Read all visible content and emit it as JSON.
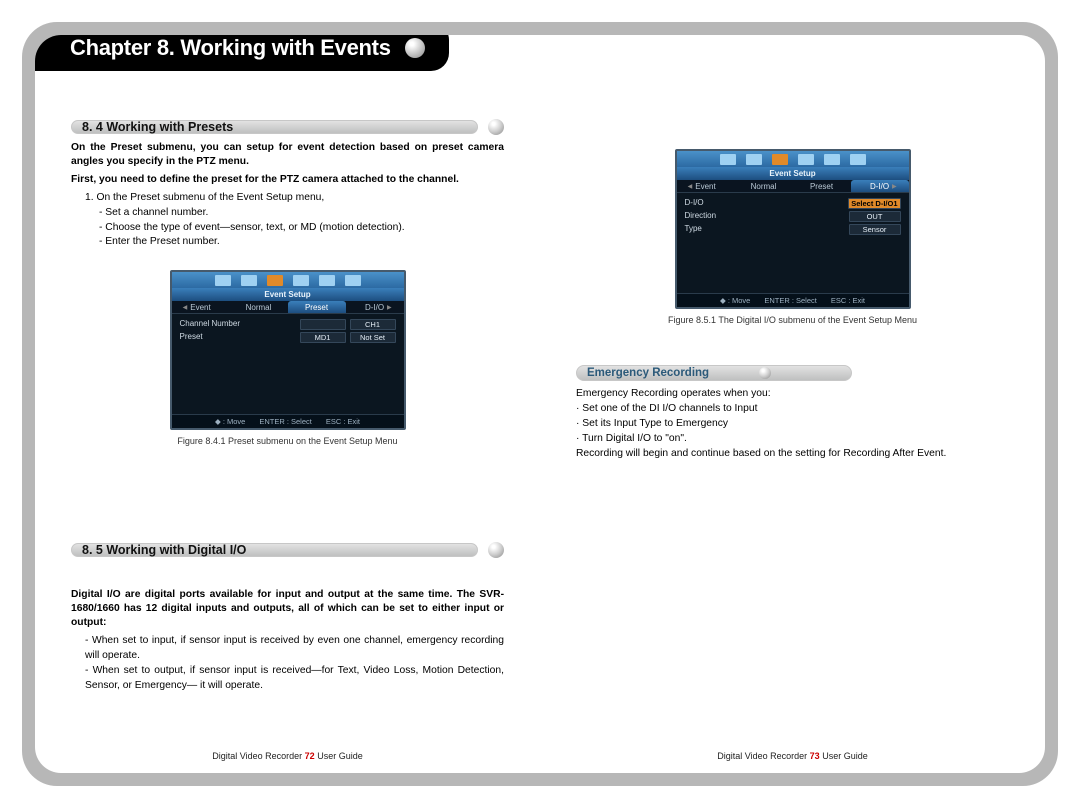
{
  "chapter_title": "Chapter 8. Working with Events",
  "left": {
    "sec84_title": "8. 4 Working with Presets",
    "p1": "On the Preset submenu, you can setup for event detection based on preset camera angles you specify in the PTZ menu.",
    "p2": "First, you need to define the preset for the PTZ camera attached to the channel.",
    "step1_intro": "1.   On the Preset submenu of the Event Setup menu,",
    "step1_a": "- Set a channel number.",
    "step1_b": "- Choose the type of event—sensor, text, or MD (motion detection).",
    "step1_c": "- Enter the Preset number.",
    "fig_caption": "Figure 8.4.1 Preset submenu on the Event Setup Menu",
    "sec85_title": "8. 5 Working with Digital I/O",
    "dio_p1": "Digital I/O are digital ports available for input and output at the same time. The SVR-1680/1660 has 12 digital inputs and outputs, all of which can be set to either input or output:",
    "dio_b1": "-  When set to input, if sensor input is received by even one channel, emergency recording will operate.",
    "dio_b2": "- When set to output, if sensor input is received—for Text, Video Loss, Motion Detection, Sensor, or Emergency— it will operate.",
    "footer_pre": "Digital Video Recorder ",
    "footer_page": "72",
    "footer_post": " User Guide"
  },
  "right": {
    "fig_caption": "Figure 8.5.1 The Digital I/O submenu of the Event Setup Menu",
    "emergency_title": "Emergency Recording",
    "er_p1": "Emergency Recording operates when you:",
    "er_b1": "· Set one of the DI I/O channels to Input",
    "er_b2": "· Set its Input Type to Emergency",
    "er_b3": "· Turn Digital I/O to \"on\".",
    "er_p2": "Recording will begin and continue based on the setting for Recording After Event.",
    "footer_pre": "Digital Video Recorder ",
    "footer_page": "73",
    "footer_post": " User Guide"
  },
  "dvr_preset": {
    "title": "Event Setup",
    "tabs": [
      "Event",
      "Normal",
      "Preset",
      "D-I/O"
    ],
    "active": 2,
    "rows": [
      {
        "label": "Channel Number",
        "v1": "",
        "v2": "CH1"
      },
      {
        "label": "Preset",
        "v1": "MD1",
        "v2": "Not Set"
      }
    ],
    "foot": [
      "◆ : Move",
      "ENTER : Select",
      "ESC : Exit"
    ]
  },
  "dvr_dio": {
    "title": "Event Setup",
    "tabs": [
      "Event",
      "Normal",
      "Preset",
      "D-I/O"
    ],
    "active": 3,
    "rows": [
      {
        "label": "D-I/O",
        "val": "Select D-I/O1",
        "hl": true
      },
      {
        "label": "Direction",
        "val": "OUT"
      },
      {
        "label": "Type",
        "val": "Sensor"
      }
    ],
    "foot": [
      "◆ : Move",
      "ENTER : Select",
      "ESC : Exit"
    ]
  }
}
